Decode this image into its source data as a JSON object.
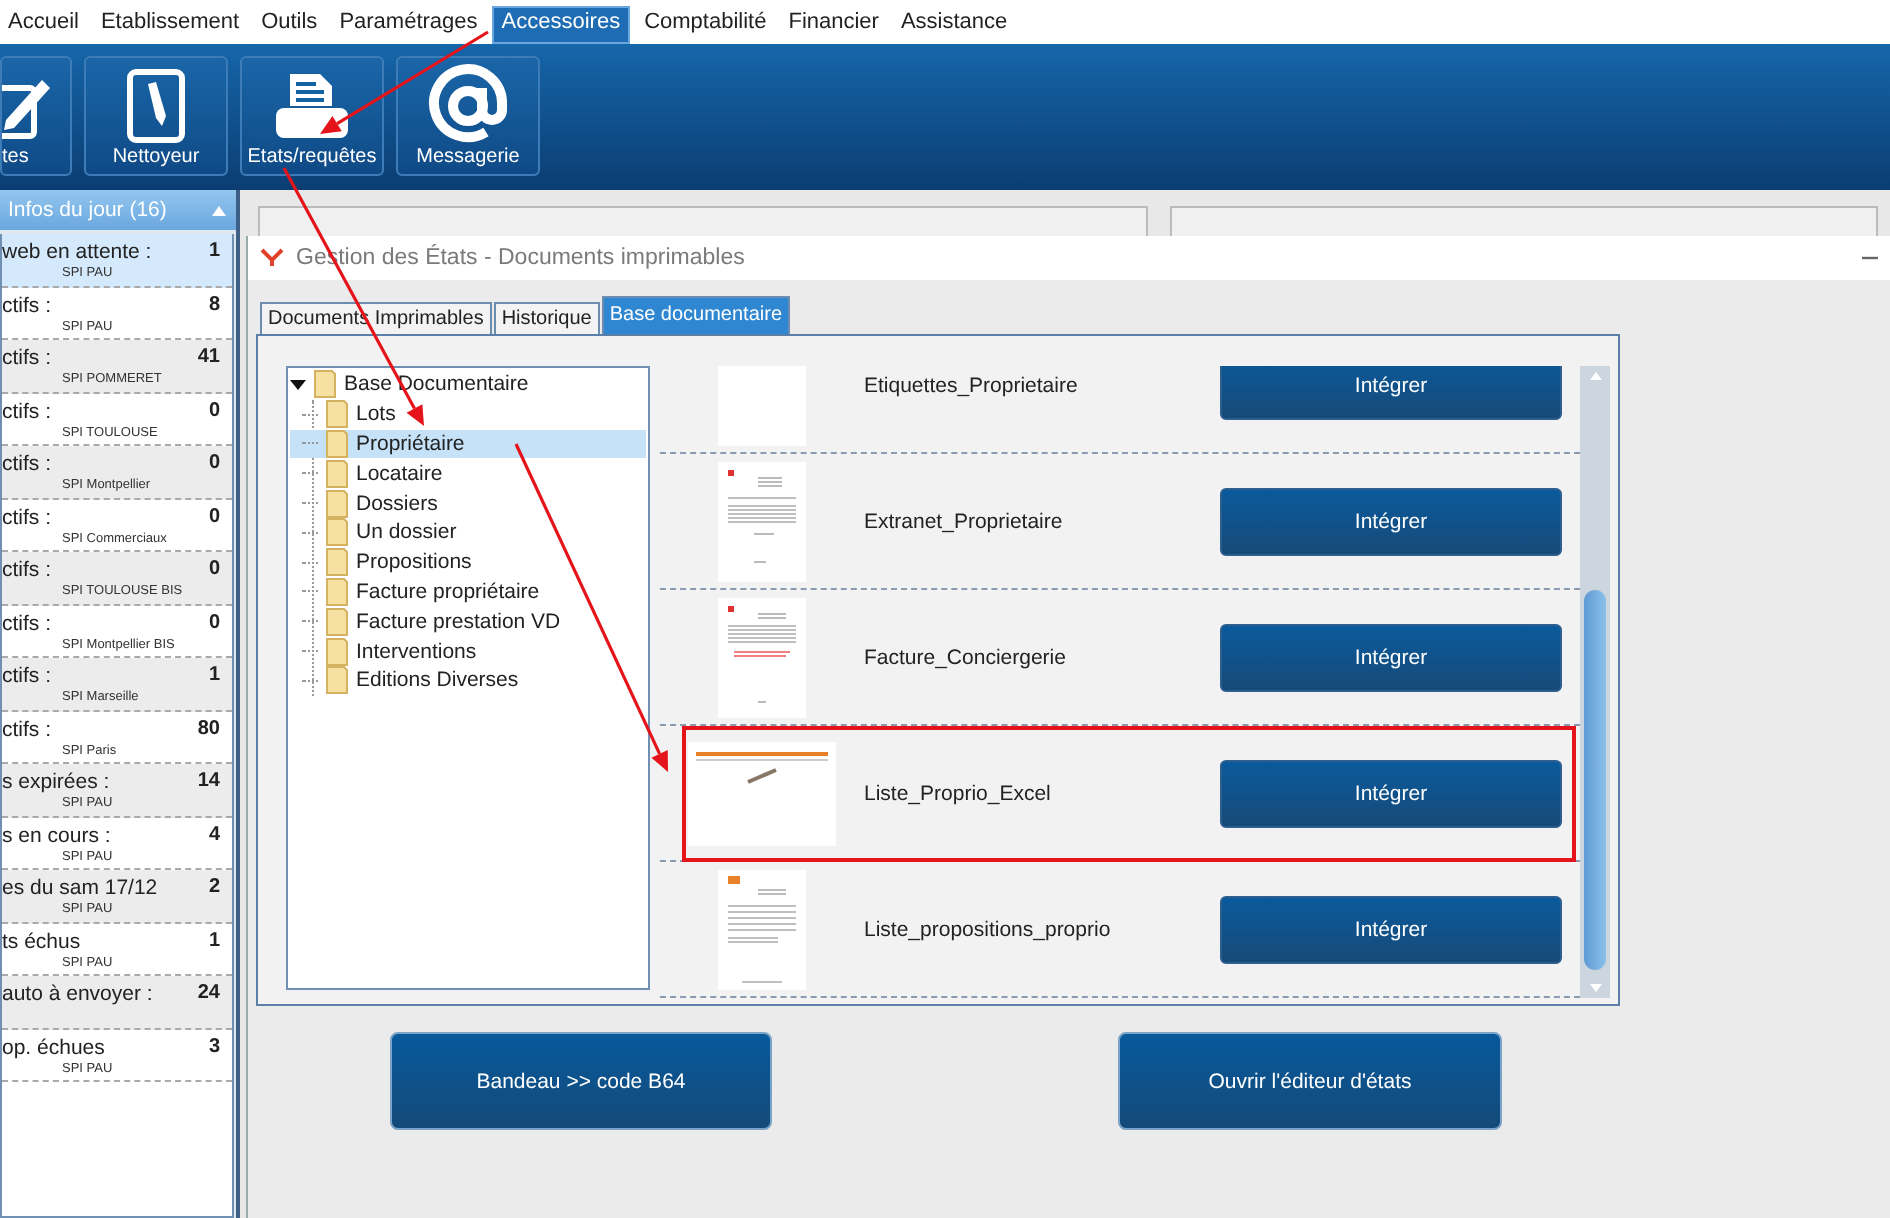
{
  "menu": [
    {
      "label": "Accueil",
      "selected": false
    },
    {
      "label": "Etablissement",
      "selected": false
    },
    {
      "label": "Outils",
      "selected": false
    },
    {
      "label": "Paramétrages",
      "selected": false
    },
    {
      "label": "Accessoires",
      "selected": true
    },
    {
      "label": "Comptabilité",
      "selected": false
    },
    {
      "label": "Financier",
      "selected": false
    },
    {
      "label": "Assistance",
      "selected": false
    }
  ],
  "ribbon": [
    {
      "label": "tes",
      "kind": "edit"
    },
    {
      "label": "Nettoyeur",
      "kind": "notepad"
    },
    {
      "label": "Etats/requêtes",
      "kind": "printer"
    },
    {
      "label": "Messagerie",
      "kind": "at"
    }
  ],
  "infos": {
    "title": "Infos du jour (16)",
    "items": [
      {
        "label": "web en attente :",
        "site": "SPI PAU",
        "count": "1",
        "selected": true
      },
      {
        "label": "ctifs :",
        "site": "SPI PAU",
        "count": "8",
        "selected": false
      },
      {
        "label": "ctifs :",
        "site": "SPI POMMERET",
        "count": "41",
        "selected": false
      },
      {
        "label": "ctifs :",
        "site": "SPI TOULOUSE",
        "count": "0",
        "selected": false
      },
      {
        "label": "ctifs :",
        "site": "SPI Montpellier",
        "count": "0",
        "selected": false
      },
      {
        "label": "ctifs :",
        "site": "SPI Commerciaux",
        "count": "0",
        "selected": false
      },
      {
        "label": "ctifs :",
        "site": "SPI TOULOUSE BIS",
        "count": "0",
        "selected": false
      },
      {
        "label": "ctifs :",
        "site": "SPI Montpellier BIS",
        "count": "0",
        "selected": false
      },
      {
        "label": "ctifs :",
        "site": "SPI Marseille",
        "count": "1",
        "selected": false
      },
      {
        "label": "ctifs :",
        "site": "SPI Paris",
        "count": "80",
        "selected": false
      },
      {
        "label": "s expirées :",
        "site": "SPI PAU",
        "count": "14",
        "selected": false
      },
      {
        "label": "s en cours :",
        "site": "SPI PAU",
        "count": "4",
        "selected": false
      },
      {
        "label": "es du sam 17/12",
        "site": "SPI PAU",
        "count": "2",
        "selected": false
      },
      {
        "label": "ts échus",
        "site": "SPI PAU",
        "count": "1",
        "selected": false
      },
      {
        "label": "auto à envoyer :",
        "count": "24",
        "selected": false
      },
      {
        "label": "op. échues",
        "site": "SPI PAU",
        "count": "3",
        "selected": false
      }
    ]
  },
  "dialog": {
    "title": "Gestion des États - Documents imprimables",
    "tabs": [
      {
        "label": "Documents Imprimables",
        "selected": false
      },
      {
        "label": "Historique",
        "selected": false
      },
      {
        "label": "Base documentaire",
        "selected": true
      }
    ],
    "tree": {
      "label": "Base Documentaire",
      "expanded": true,
      "selected": false,
      "children": [
        {
          "label": "Lots",
          "selected": false
        },
        {
          "label": "Propriétaire",
          "selected": true
        },
        {
          "label": "Locataire",
          "selected": false
        },
        {
          "label": "Dossiers",
          "selected": false
        },
        {
          "label": "Un dossier",
          "selected": false
        },
        {
          "label": "Propositions",
          "selected": false
        },
        {
          "label": "Facture propriétaire",
          "selected": false
        },
        {
          "label": "Facture prestation VD",
          "selected": false
        },
        {
          "label": "Interventions",
          "selected": false
        },
        {
          "label": "Editions Diverses",
          "selected": false
        }
      ]
    },
    "documents": [
      {
        "name": "Etiquettes_Proprietaire",
        "kind": "blank",
        "button": "Intégrer",
        "highlighted": false
      },
      {
        "name": "Extranet_Proprietaire",
        "kind": "letter",
        "button": "Intégrer",
        "highlighted": false
      },
      {
        "name": "Facture_Conciergerie",
        "kind": "invoice",
        "button": "Intégrer",
        "highlighted": false
      },
      {
        "name": "Liste_Proprio_Excel",
        "kind": "spreadsheet",
        "button": "Intégrer",
        "highlighted": true
      },
      {
        "name": "Liste_propositions_proprio",
        "kind": "table",
        "button": "Intégrer",
        "highlighted": false
      }
    ],
    "buttons": [
      "Bandeau >> code B64",
      "Ouvrir l'éditeur d'états"
    ]
  }
}
